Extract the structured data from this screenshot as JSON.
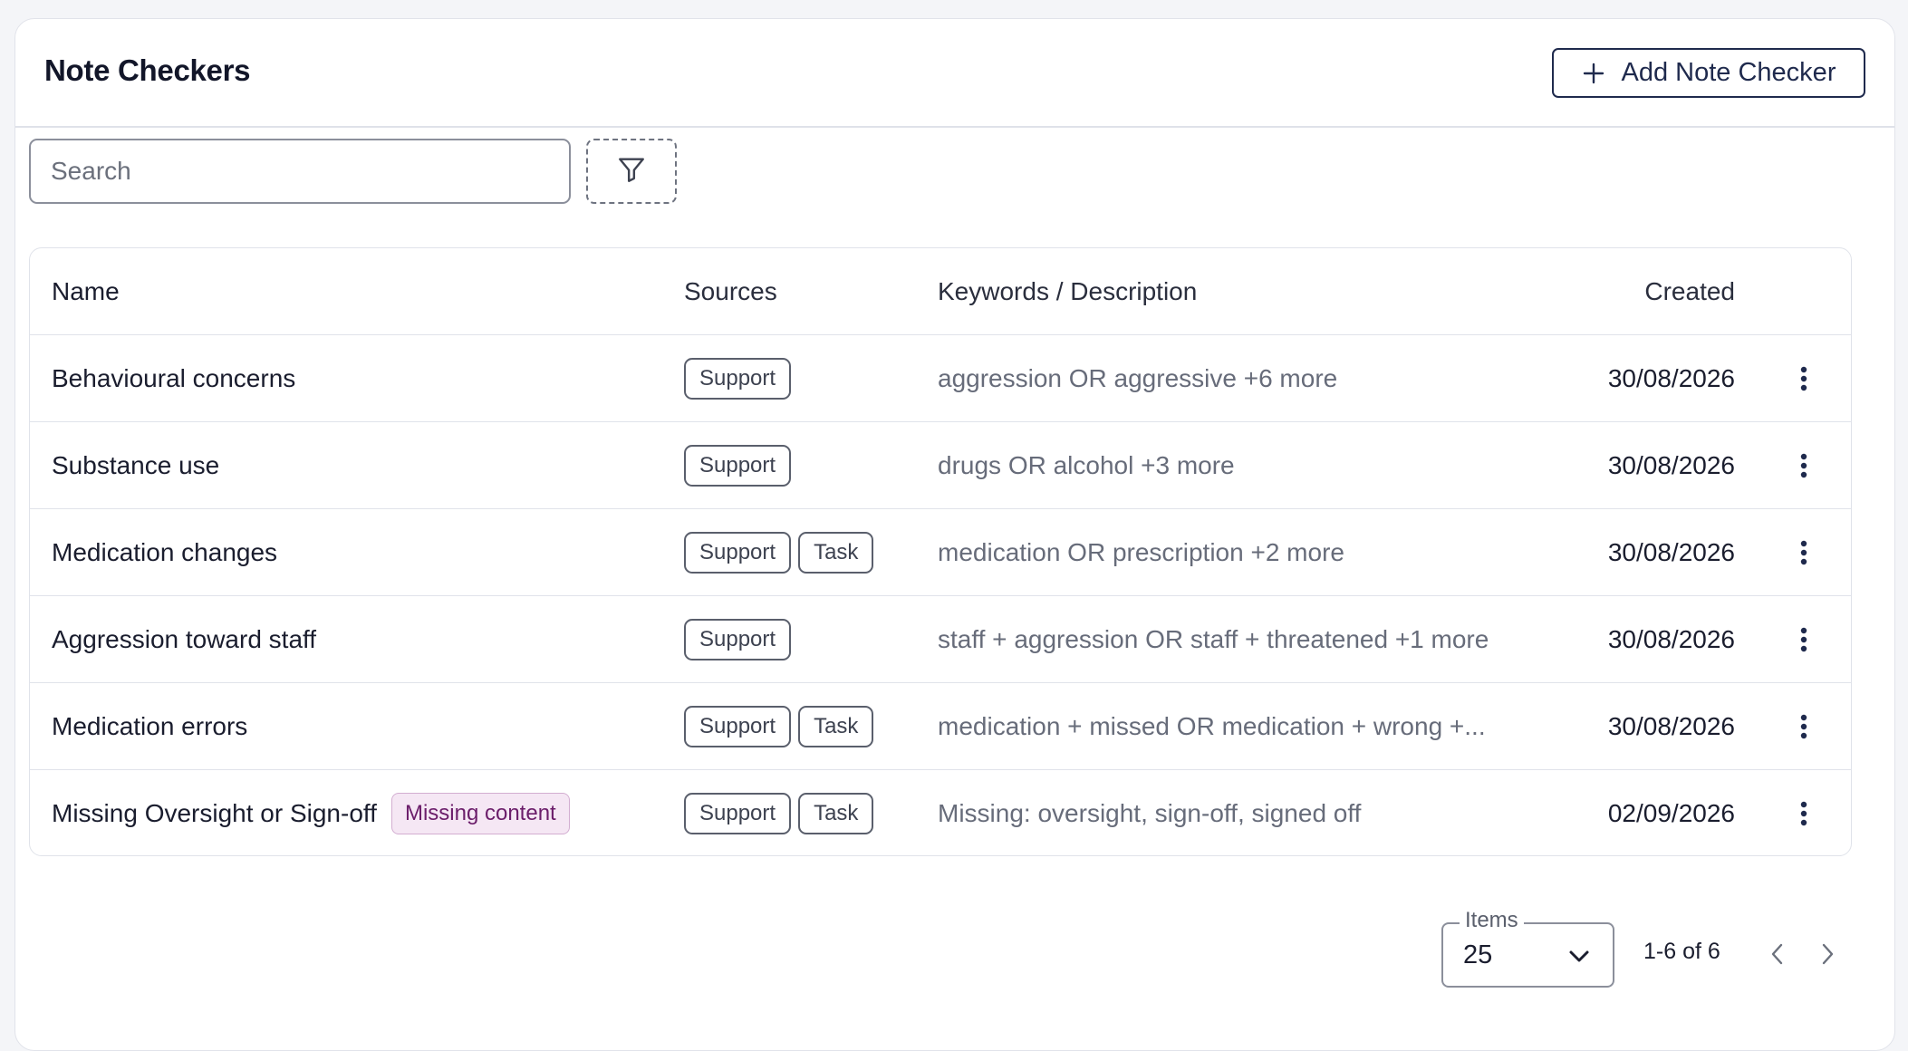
{
  "header": {
    "title": "Note Checkers",
    "add_button_label": "Add Note Checker",
    "add_button_icon": "plus-icon"
  },
  "toolbar": {
    "search_placeholder": "Search",
    "search_value": "",
    "filter_icon": "filter-icon"
  },
  "table": {
    "columns": {
      "name": "Name",
      "sources": "Sources",
      "keywords": "Keywords / Description",
      "created": "Created"
    },
    "rows": [
      {
        "name": "Behavioural concerns",
        "tag": "",
        "sources": [
          "Support"
        ],
        "keywords": "aggression OR aggressive +6 more",
        "created": "30/08/2026"
      },
      {
        "name": "Substance use",
        "tag": "",
        "sources": [
          "Support"
        ],
        "keywords": "drugs OR alcohol +3 more",
        "created": "30/08/2026"
      },
      {
        "name": "Medication changes",
        "tag": "",
        "sources": [
          "Support",
          "Task"
        ],
        "keywords": "medication OR prescription +2 more",
        "created": "30/08/2026"
      },
      {
        "name": "Aggression toward staff",
        "tag": "",
        "sources": [
          "Support"
        ],
        "keywords": "staff + aggression OR staff + threatened +1 more",
        "created": "30/08/2026"
      },
      {
        "name": "Medication errors",
        "tag": "",
        "sources": [
          "Support",
          "Task"
        ],
        "keywords": "medication + missed OR medication + wrong +...",
        "created": "30/08/2026"
      },
      {
        "name": "Missing Oversight or Sign-off",
        "tag": "Missing content",
        "sources": [
          "Support",
          "Task"
        ],
        "keywords": "Missing: oversight, sign-off, signed off",
        "created": "02/09/2026"
      }
    ],
    "row_menu_icon": "kebab-menu-icon"
  },
  "pagination": {
    "items_label": "Items",
    "items_per_page": "25",
    "range_text": "1-6 of 6",
    "prev_icon": "chevron-left-icon",
    "next_icon": "chevron-right-icon"
  },
  "colors": {
    "primary": "#1f2a4d",
    "tag_background": "#f5e7f4",
    "tag_text": "#6b1d6a",
    "muted_text": "#676c7a"
  }
}
